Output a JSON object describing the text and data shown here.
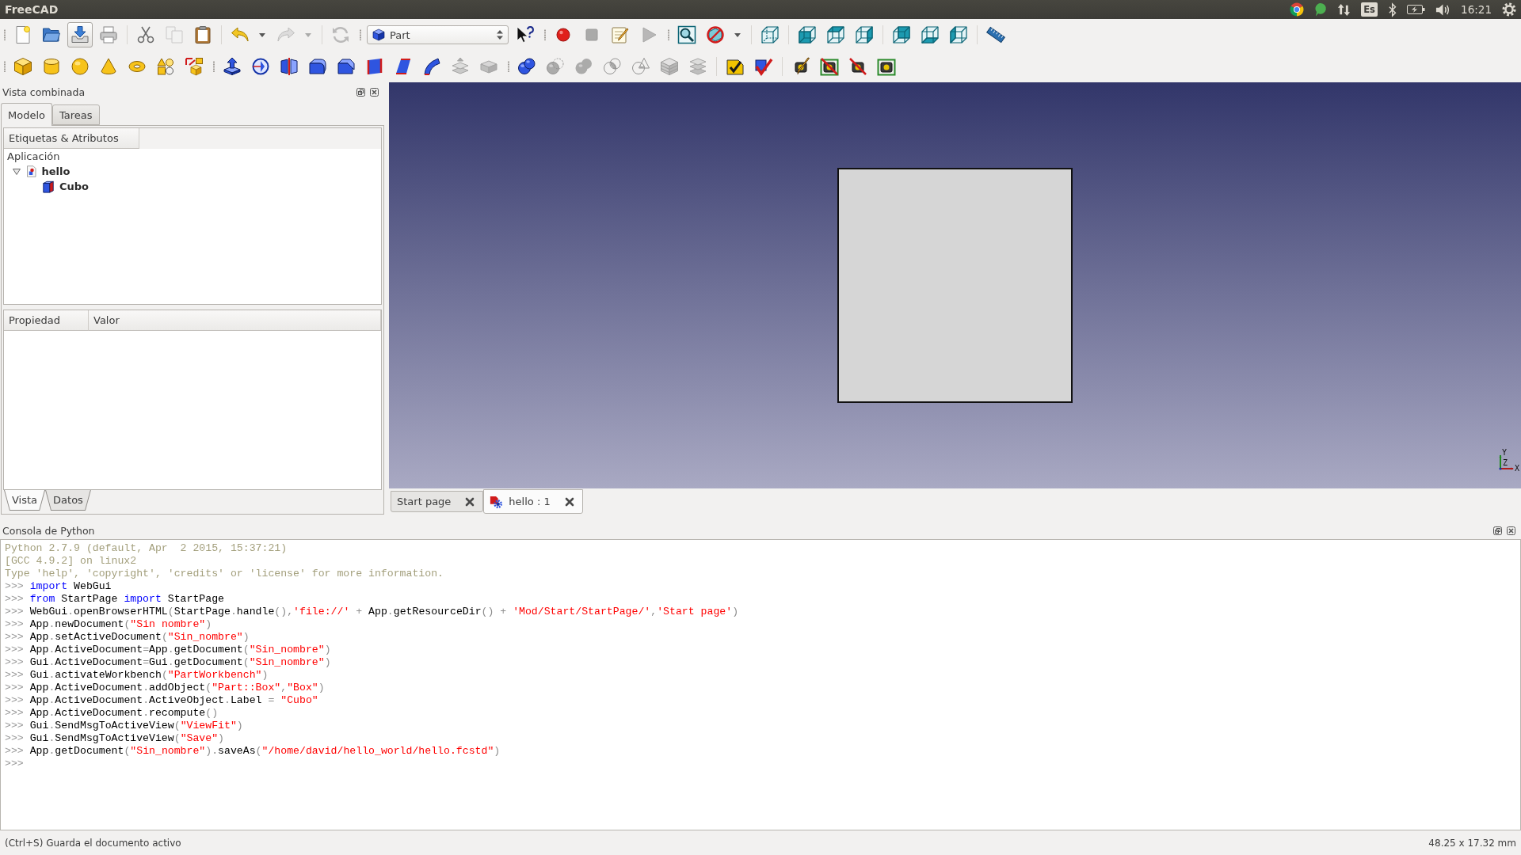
{
  "top_bar": {
    "title": "FreeCAD",
    "keyboard_layout": "Es",
    "clock": "16:21"
  },
  "toolbar_rows": [
    {
      "toolbars": [
        {
          "groups": [
            [
              {
                "kind": "button",
                "disabled": false,
                "hovered": false
              },
              {
                "kind": "button",
                "disabled": false,
                "hovered": false
              },
              {
                "kind": "button",
                "disabled": false,
                "hovered": true
              },
              {
                "kind": "button",
                "disabled": false,
                "hovered": false
              }
            ],
            [
              {
                "kind": "button",
                "disabled": false,
                "hovered": false
              },
              {
                "kind": "button",
                "disabled": true,
                "hovered": false
              },
              {
                "kind": "button",
                "disabled": false,
                "hovered": false
              }
            ],
            [
              {
                "kind": "split",
                "disabled": false,
                "hovered": false
              },
              {
                "kind": "split",
                "disabled": true,
                "hovered": false
              }
            ],
            [
              {
                "kind": "button",
                "disabled": true,
                "hovered": false
              }
            ]
          ]
        },
        {
          "groups": [
            [
              {
                "kind": "combo",
                "value": "Part",
                "disabled": false,
                "hovered": false
              },
              {
                "kind": "button",
                "disabled": false,
                "hovered": false
              }
            ]
          ]
        },
        {
          "groups": [
            [
              {
                "kind": "button",
                "disabled": false,
                "hovered": false
              },
              {
                "kind": "button",
                "disabled": true,
                "hovered": false
              },
              {
                "kind": "button",
                "disabled": false,
                "hovered": false
              },
              {
                "kind": "button",
                "disabled": true,
                "hovered": false
              }
            ]
          ]
        },
        {
          "groups": [
            [
              {
                "kind": "button",
                "disabled": false,
                "hovered": false
              },
              {
                "kind": "split",
                "disabled": false,
                "hovered": false
              }
            ],
            [
              {
                "kind": "button",
                "disabled": false,
                "hovered": false
              }
            ],
            [
              {
                "kind": "button",
                "disabled": false,
                "hovered": false
              },
              {
                "kind": "button",
                "disabled": false,
                "hovered": false
              },
              {
                "kind": "button",
                "disabled": false,
                "hovered": false
              }
            ],
            [
              {
                "kind": "button",
                "disabled": false,
                "hovered": false
              },
              {
                "kind": "button",
                "disabled": false,
                "hovered": false
              },
              {
                "kind": "button",
                "disabled": false,
                "hovered": false
              }
            ],
            [
              {
                "kind": "button",
                "disabled": false,
                "hovered": false
              }
            ]
          ]
        }
      ]
    },
    {
      "toolbars": [
        {
          "groups": [
            [
              {
                "kind": "button",
                "disabled": false,
                "hovered": false
              },
              {
                "kind": "button",
                "disabled": false,
                "hovered": false
              },
              {
                "kind": "button",
                "disabled": false,
                "hovered": false
              },
              {
                "kind": "button",
                "disabled": false,
                "hovered": false
              },
              {
                "kind": "button",
                "disabled": false,
                "hovered": false
              },
              {
                "kind": "button",
                "disabled": false,
                "hovered": false
              },
              {
                "kind": "button",
                "disabled": false,
                "hovered": false
              }
            ]
          ]
        },
        {
          "groups": [
            [
              {
                "kind": "button",
                "disabled": false,
                "hovered": false
              },
              {
                "kind": "button",
                "disabled": false,
                "hovered": false
              },
              {
                "kind": "button",
                "disabled": false,
                "hovered": false
              },
              {
                "kind": "button",
                "disabled": false,
                "hovered": false
              },
              {
                "kind": "button",
                "disabled": false,
                "hovered": false
              },
              {
                "kind": "button",
                "disabled": false,
                "hovered": false
              },
              {
                "kind": "button",
                "disabled": false,
                "hovered": false
              },
              {
                "kind": "button",
                "disabled": false,
                "hovered": false
              },
              {
                "kind": "button",
                "disabled": true,
                "hovered": false
              },
              {
                "kind": "button",
                "disabled": true,
                "hovered": false
              }
            ]
          ]
        },
        {
          "groups": [
            [
              {
                "kind": "button",
                "disabled": false,
                "hovered": false
              },
              {
                "kind": "button",
                "disabled": true,
                "hovered": false
              },
              {
                "kind": "button",
                "disabled": true,
                "hovered": false
              },
              {
                "kind": "button",
                "disabled": true,
                "hovered": false
              },
              {
                "kind": "button",
                "disabled": true,
                "hovered": false
              },
              {
                "kind": "button",
                "disabled": true,
                "hovered": false
              },
              {
                "kind": "button",
                "disabled": true,
                "hovered": false
              }
            ],
            [
              {
                "kind": "button",
                "disabled": false,
                "hovered": false
              },
              {
                "kind": "button",
                "disabled": false,
                "hovered": false
              }
            ],
            [
              {
                "kind": "button",
                "disabled": false,
                "hovered": false
              },
              {
                "kind": "button",
                "disabled": false,
                "hovered": false
              },
              {
                "kind": "button",
                "disabled": false,
                "hovered": false
              },
              {
                "kind": "button",
                "disabled": false,
                "hovered": false
              }
            ]
          ]
        }
      ]
    }
  ],
  "combo_view": {
    "title": "Vista combinada",
    "tabs": [
      {
        "label": "Modelo",
        "selected": true
      },
      {
        "label": "Tareas",
        "selected": false
      }
    ],
    "tree": {
      "header": "Etiquetas & Atributos",
      "root": "Aplicación",
      "items": [
        {
          "kind": "document",
          "label": "hello",
          "expanded": true,
          "children": [
            {
              "kind": "object",
              "label": "Cubo"
            }
          ]
        }
      ]
    },
    "properties": {
      "columns": [
        "Propiedad",
        "Valor"
      ]
    },
    "view_tabs": [
      {
        "label": "Vista",
        "selected": true
      },
      {
        "label": "Datos",
        "selected": false
      }
    ]
  },
  "view_3d": {
    "axis_labels": [
      {
        "kind": "y",
        "text": "Y"
      },
      {
        "kind": "z",
        "text": "Z"
      },
      {
        "kind": "x",
        "text": "X"
      }
    ]
  },
  "document_tabs": [
    {
      "kind": "web",
      "label": "Start page",
      "selected": false
    },
    {
      "kind": "document",
      "label": "hello : 1",
      "selected": true
    }
  ],
  "python_console": {
    "title": "Consola de Python",
    "lines": [
      {
        "segments": [
          {
            "kind": "info",
            "text": "Python 2.7.9 (default, Apr  2 2015, 15:37:21)"
          }
        ]
      },
      {
        "segments": [
          {
            "kind": "info",
            "text": "[GCC 4.9.2] on linux2"
          }
        ]
      },
      {
        "segments": [
          {
            "kind": "info",
            "text": "Type 'help', 'copyright', 'credits' or 'license' for more information."
          }
        ]
      },
      {
        "segments": [
          {
            "kind": "prompt",
            "text": ">>> "
          },
          {
            "kind": "keyword",
            "text": "import"
          },
          {
            "kind": "text",
            "text": " WebGui"
          }
        ]
      },
      {
        "segments": [
          {
            "kind": "prompt",
            "text": ">>> "
          },
          {
            "kind": "keyword",
            "text": "from"
          },
          {
            "kind": "text",
            "text": " StartPage "
          },
          {
            "kind": "keyword",
            "text": "import"
          },
          {
            "kind": "text",
            "text": " StartPage"
          }
        ]
      },
      {
        "segments": [
          {
            "kind": "prompt",
            "text": ">>> "
          },
          {
            "kind": "text",
            "text": "WebGui"
          },
          {
            "kind": "op",
            "text": "."
          },
          {
            "kind": "text",
            "text": "openBrowserHTML"
          },
          {
            "kind": "op",
            "text": "("
          },
          {
            "kind": "text",
            "text": "StartPage"
          },
          {
            "kind": "op",
            "text": "."
          },
          {
            "kind": "text",
            "text": "handle"
          },
          {
            "kind": "op",
            "text": "(),"
          },
          {
            "kind": "string",
            "text": "'file://'"
          },
          {
            "kind": "op",
            "text": " + "
          },
          {
            "kind": "text",
            "text": "App"
          },
          {
            "kind": "op",
            "text": "."
          },
          {
            "kind": "text",
            "text": "getResourceDir"
          },
          {
            "kind": "op",
            "text": "() + "
          },
          {
            "kind": "string",
            "text": "'Mod/Start/StartPage/'"
          },
          {
            "kind": "op",
            "text": ","
          },
          {
            "kind": "string",
            "text": "'Start page'"
          },
          {
            "kind": "op",
            "text": ")"
          }
        ]
      },
      {
        "segments": [
          {
            "kind": "prompt",
            "text": ">>> "
          },
          {
            "kind": "text",
            "text": "App"
          },
          {
            "kind": "op",
            "text": "."
          },
          {
            "kind": "text",
            "text": "newDocument"
          },
          {
            "kind": "op",
            "text": "("
          },
          {
            "kind": "string",
            "text": "\"Sin nombre\""
          },
          {
            "kind": "op",
            "text": ")"
          }
        ]
      },
      {
        "segments": [
          {
            "kind": "prompt",
            "text": ">>> "
          },
          {
            "kind": "text",
            "text": "App"
          },
          {
            "kind": "op",
            "text": "."
          },
          {
            "kind": "text",
            "text": "setActiveDocument"
          },
          {
            "kind": "op",
            "text": "("
          },
          {
            "kind": "string",
            "text": "\"Sin_nombre\""
          },
          {
            "kind": "op",
            "text": ")"
          }
        ]
      },
      {
        "segments": [
          {
            "kind": "prompt",
            "text": ">>> "
          },
          {
            "kind": "text",
            "text": "App"
          },
          {
            "kind": "op",
            "text": "."
          },
          {
            "kind": "text",
            "text": "ActiveDocument"
          },
          {
            "kind": "op",
            "text": "="
          },
          {
            "kind": "text",
            "text": "App"
          },
          {
            "kind": "op",
            "text": "."
          },
          {
            "kind": "text",
            "text": "getDocument"
          },
          {
            "kind": "op",
            "text": "("
          },
          {
            "kind": "string",
            "text": "\"Sin_nombre\""
          },
          {
            "kind": "op",
            "text": ")"
          }
        ]
      },
      {
        "segments": [
          {
            "kind": "prompt",
            "text": ">>> "
          },
          {
            "kind": "text",
            "text": "Gui"
          },
          {
            "kind": "op",
            "text": "."
          },
          {
            "kind": "text",
            "text": "ActiveDocument"
          },
          {
            "kind": "op",
            "text": "="
          },
          {
            "kind": "text",
            "text": "Gui"
          },
          {
            "kind": "op",
            "text": "."
          },
          {
            "kind": "text",
            "text": "getDocument"
          },
          {
            "kind": "op",
            "text": "("
          },
          {
            "kind": "string",
            "text": "\"Sin_nombre\""
          },
          {
            "kind": "op",
            "text": ")"
          }
        ]
      },
      {
        "segments": [
          {
            "kind": "prompt",
            "text": ">>> "
          },
          {
            "kind": "text",
            "text": "Gui"
          },
          {
            "kind": "op",
            "text": "."
          },
          {
            "kind": "text",
            "text": "activateWorkbench"
          },
          {
            "kind": "op",
            "text": "("
          },
          {
            "kind": "string",
            "text": "\"PartWorkbench\""
          },
          {
            "kind": "op",
            "text": ")"
          }
        ]
      },
      {
        "segments": [
          {
            "kind": "prompt",
            "text": ">>> "
          },
          {
            "kind": "text",
            "text": "App"
          },
          {
            "kind": "op",
            "text": "."
          },
          {
            "kind": "text",
            "text": "ActiveDocument"
          },
          {
            "kind": "op",
            "text": "."
          },
          {
            "kind": "text",
            "text": "addObject"
          },
          {
            "kind": "op",
            "text": "("
          },
          {
            "kind": "string",
            "text": "\"Part::Box\""
          },
          {
            "kind": "op",
            "text": ","
          },
          {
            "kind": "string",
            "text": "\"Box\""
          },
          {
            "kind": "op",
            "text": ")"
          }
        ]
      },
      {
        "segments": [
          {
            "kind": "prompt",
            "text": ">>> "
          },
          {
            "kind": "text",
            "text": "App"
          },
          {
            "kind": "op",
            "text": "."
          },
          {
            "kind": "text",
            "text": "ActiveDocument"
          },
          {
            "kind": "op",
            "text": "."
          },
          {
            "kind": "text",
            "text": "ActiveObject"
          },
          {
            "kind": "op",
            "text": "."
          },
          {
            "kind": "text",
            "text": "Label"
          },
          {
            "kind": "op",
            "text": " = "
          },
          {
            "kind": "string",
            "text": "\"Cubo\""
          }
        ]
      },
      {
        "segments": [
          {
            "kind": "prompt",
            "text": ">>> "
          },
          {
            "kind": "text",
            "text": "App"
          },
          {
            "kind": "op",
            "text": "."
          },
          {
            "kind": "text",
            "text": "ActiveDocument"
          },
          {
            "kind": "op",
            "text": "."
          },
          {
            "kind": "text",
            "text": "recompute"
          },
          {
            "kind": "op",
            "text": "()"
          }
        ]
      },
      {
        "segments": [
          {
            "kind": "prompt",
            "text": ">>> "
          },
          {
            "kind": "text",
            "text": "Gui"
          },
          {
            "kind": "op",
            "text": "."
          },
          {
            "kind": "text",
            "text": "SendMsgToActiveView"
          },
          {
            "kind": "op",
            "text": "("
          },
          {
            "kind": "string",
            "text": "\"ViewFit\""
          },
          {
            "kind": "op",
            "text": ")"
          }
        ]
      },
      {
        "segments": [
          {
            "kind": "prompt",
            "text": ">>> "
          },
          {
            "kind": "text",
            "text": "Gui"
          },
          {
            "kind": "op",
            "text": "."
          },
          {
            "kind": "text",
            "text": "SendMsgToActiveView"
          },
          {
            "kind": "op",
            "text": "("
          },
          {
            "kind": "string",
            "text": "\"Save\""
          },
          {
            "kind": "op",
            "text": ")"
          }
        ]
      },
      {
        "segments": [
          {
            "kind": "prompt",
            "text": ">>> "
          },
          {
            "kind": "text",
            "text": "App"
          },
          {
            "kind": "op",
            "text": "."
          },
          {
            "kind": "text",
            "text": "getDocument"
          },
          {
            "kind": "op",
            "text": "("
          },
          {
            "kind": "string",
            "text": "\"Sin_nombre\""
          },
          {
            "kind": "op",
            "text": ")."
          },
          {
            "kind": "text",
            "text": "saveAs"
          },
          {
            "kind": "op",
            "text": "("
          },
          {
            "kind": "string",
            "text": "\"/home/david/hello_world/hello.fcstd\""
          },
          {
            "kind": "op",
            "text": ")"
          }
        ]
      },
      {
        "segments": [
          {
            "kind": "prompt",
            "text": ">>>"
          }
        ]
      }
    ]
  },
  "status_bar": {
    "message": "(Ctrl+S) Guarda el documento activo",
    "dimensions": "48.25 x 17.32 mm"
  }
}
